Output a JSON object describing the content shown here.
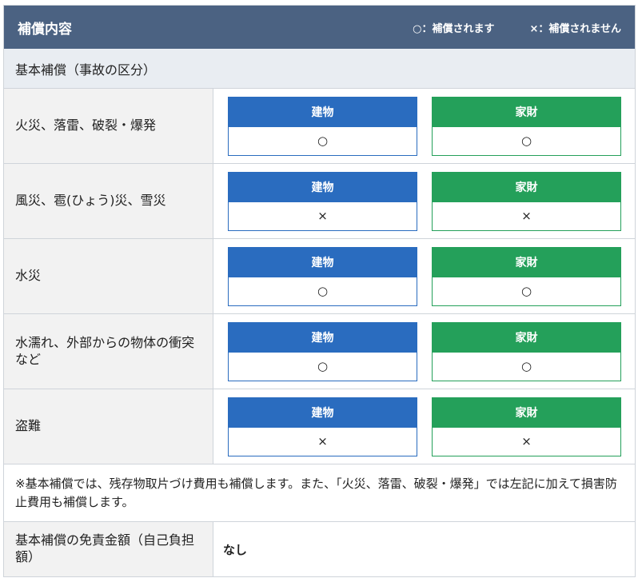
{
  "header": {
    "title": "補償内容",
    "legend_covered": "○：補償されます",
    "legend_not_covered": "×：補償されません"
  },
  "section_title": "基本補償（事故の区分）",
  "rows": [
    {
      "label": "火災、落雷、破裂・爆発",
      "building_label": "建物",
      "building_value": "○",
      "contents_label": "家財",
      "contents_value": "○"
    },
    {
      "label": "風災、雹(ひょう)災、雪災",
      "building_label": "建物",
      "building_value": "×",
      "contents_label": "家財",
      "contents_value": "×"
    },
    {
      "label": "水災",
      "building_label": "建物",
      "building_value": "○",
      "contents_label": "家財",
      "contents_value": "○"
    },
    {
      "label": "水濡れ、外部からの物体の衝突など",
      "building_label": "建物",
      "building_value": "○",
      "contents_label": "家財",
      "contents_value": "○"
    },
    {
      "label": "盗難",
      "building_label": "建物",
      "building_value": "×",
      "contents_label": "家財",
      "contents_value": "×"
    }
  ],
  "note": "※基本補償では、残存物取片づけ費用も補償します。また、「火災、落雷、破裂・爆発」では左記に加えて損害防止費用も補償します。",
  "deductible": {
    "label": "基本補償の免責金額（自己負担額）",
    "value": "なし"
  },
  "colors": {
    "header_bg": "#4b6282",
    "building": "#2a6cbf",
    "contents": "#24a05a"
  }
}
